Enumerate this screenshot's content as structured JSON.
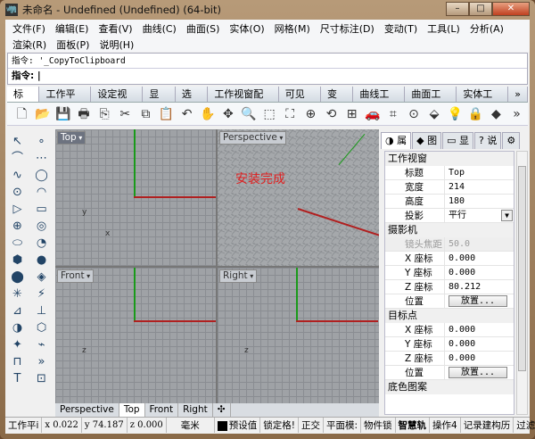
{
  "window": {
    "title": "未命名 - Undefined (Undefined) (64-bit)",
    "minimize": "–",
    "maximize": "□",
    "close": "✕"
  },
  "menu": [
    "文件(F)",
    "编辑(E)",
    "查看(V)",
    "曲线(C)",
    "曲面(S)",
    "实体(O)",
    "网格(M)",
    "尺寸标注(D)",
    "变动(T)",
    "工具(L)",
    "分析(A)",
    "渲染(R)",
    "面板(P)",
    "说明(H)"
  ],
  "command": {
    "history": "指令: '_CopyToClipboard",
    "prompt": "指令:"
  },
  "tabs": [
    "标准",
    "工作平面",
    "设定视图",
    "显示",
    "选取",
    "工作视窗配置",
    "可见性",
    "变动",
    "曲线工具",
    "曲面工具",
    "实体工具",
    "»"
  ],
  "toolbar": [
    {
      "icon": "new-file-icon",
      "g": "🗋"
    },
    {
      "icon": "open-icon",
      "g": "📂"
    },
    {
      "icon": "save-icon",
      "g": "💾"
    },
    {
      "icon": "print-icon",
      "g": "🖶"
    },
    {
      "icon": "import-icon",
      "g": "⎘"
    },
    {
      "icon": "cut-icon",
      "g": "✂"
    },
    {
      "icon": "copy-icon",
      "g": "⧉"
    },
    {
      "icon": "paste-icon",
      "g": "📋"
    },
    {
      "icon": "undo-icon",
      "g": "↶"
    },
    {
      "icon": "pan-icon",
      "g": "✋"
    },
    {
      "icon": "rotate-view-icon",
      "g": "✥"
    },
    {
      "icon": "zoom-icon",
      "g": "🔍"
    },
    {
      "icon": "zoom-window-icon",
      "g": "⬚"
    },
    {
      "icon": "zoom-extents-icon",
      "g": "⛶"
    },
    {
      "icon": "zoom-selected-icon",
      "g": "⊕"
    },
    {
      "icon": "undo-view-icon",
      "g": "⟲"
    },
    {
      "icon": "four-viewports-icon",
      "g": "⊞"
    },
    {
      "icon": "car-icon",
      "g": "🚗"
    },
    {
      "icon": "grid-snap-icon",
      "g": "⌗"
    },
    {
      "icon": "cplane-icon",
      "g": "⊙"
    },
    {
      "icon": "select-icon",
      "g": "⬙"
    },
    {
      "icon": "light-icon",
      "g": "💡"
    },
    {
      "icon": "lock-icon",
      "g": "🔒"
    },
    {
      "icon": "render-icon",
      "g": "◆"
    },
    {
      "icon": "more-icon",
      "g": "»"
    }
  ],
  "left_tools": [
    "↖",
    "∘",
    "⌒",
    "⋯",
    "∿",
    "◯",
    "⊙",
    "◠",
    "▷",
    "▭",
    "⊕",
    "◎",
    "⬭",
    "◔",
    "⬢",
    "●",
    "⬤",
    "◈",
    "✳",
    "⚡",
    "⊿",
    "⊥",
    "◑",
    "⬡",
    "✦",
    "⌁",
    "⊓",
    "»",
    "T",
    "⊡"
  ],
  "viewports": [
    {
      "name": "Top",
      "active": true
    },
    {
      "name": "Perspective",
      "active": false,
      "overlay": "安装完成"
    },
    {
      "name": "Front",
      "active": false
    },
    {
      "name": "Right",
      "active": false
    }
  ],
  "axis_labels": {
    "x": "x",
    "y": "y",
    "z": "z"
  },
  "viewport_tabs": [
    "Perspective",
    "Top",
    "Front",
    "Right",
    "✣"
  ],
  "panel": {
    "tabs": [
      "属",
      "图",
      "显",
      "说"
    ],
    "sections": [
      {
        "title": "工作视窗",
        "rows": [
          {
            "k": "标题",
            "v": "Top"
          },
          {
            "k": "宽度",
            "v": "214"
          },
          {
            "k": "高度",
            "v": "180"
          },
          {
            "k": "投影",
            "v": "平行",
            "dropdown": true
          }
        ]
      },
      {
        "title": "摄影机",
        "rows": [
          {
            "k": "镜头焦距",
            "v": "50.0",
            "disabled": true
          },
          {
            "k": "X 座标",
            "v": "0.000"
          },
          {
            "k": "Y 座标",
            "v": "0.000"
          },
          {
            "k": "Z 座标",
            "v": "80.212"
          },
          {
            "k": "位置",
            "button": "放置..."
          }
        ]
      },
      {
        "title": "目标点",
        "rows": [
          {
            "k": "X 座标",
            "v": "0.000"
          },
          {
            "k": "Y 座标",
            "v": "0.000"
          },
          {
            "k": "Z 座标",
            "v": "0.000"
          },
          {
            "k": "位置",
            "button": "放置..."
          }
        ]
      },
      {
        "title": "底色图案",
        "rows": []
      }
    ]
  },
  "status": {
    "cplane": "工作平i",
    "x": "x 0.022",
    "y": "y 74.187",
    "z": "z 0.000",
    "units": "毫米",
    "layer": "预设值",
    "toggles": [
      "锁定格!",
      "正交",
      "平面模:",
      "物件锁",
      "智慧轨",
      "操作4",
      "记录建构历",
      "过滤"
    ],
    "bold_toggles": [
      "智慧轨"
    ]
  }
}
